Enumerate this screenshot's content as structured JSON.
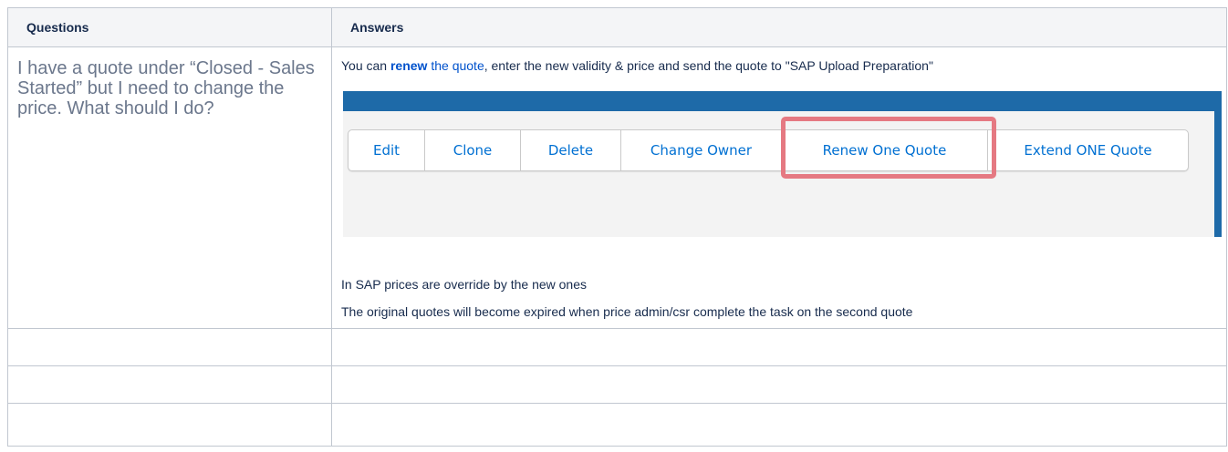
{
  "table": {
    "headers": {
      "questions": "Questions",
      "answers": "Answers"
    },
    "rows": [
      {
        "question": "I have a quote under “Closed - Sales Started” but I need to change the price. What should I do?",
        "answer": {
          "prefix": "You can ",
          "link_bold": "renew",
          "link_rest": " the quote",
          "suffix": ", enter the new validity & price and send the quote to \"SAP Upload Preparation\"",
          "screenshot": {
            "buttons": [
              "Edit",
              "Clone",
              "Delete",
              "Change Owner",
              "Renew One Quote",
              "Extend ONE Quote"
            ],
            "highlighted_button": "Renew One Quote",
            "highlight_color": "#e57982",
            "button_text_color": "#0070d2",
            "banner_color": "#1e6aa8"
          },
          "note1": "In SAP prices are override by the new ones",
          "note2": "The original quotes will become expired when price admin/csr complete the task on the second quote"
        }
      },
      {
        "question": "",
        "answer": ""
      },
      {
        "question": "",
        "answer": ""
      },
      {
        "question": "",
        "answer": ""
      }
    ]
  }
}
